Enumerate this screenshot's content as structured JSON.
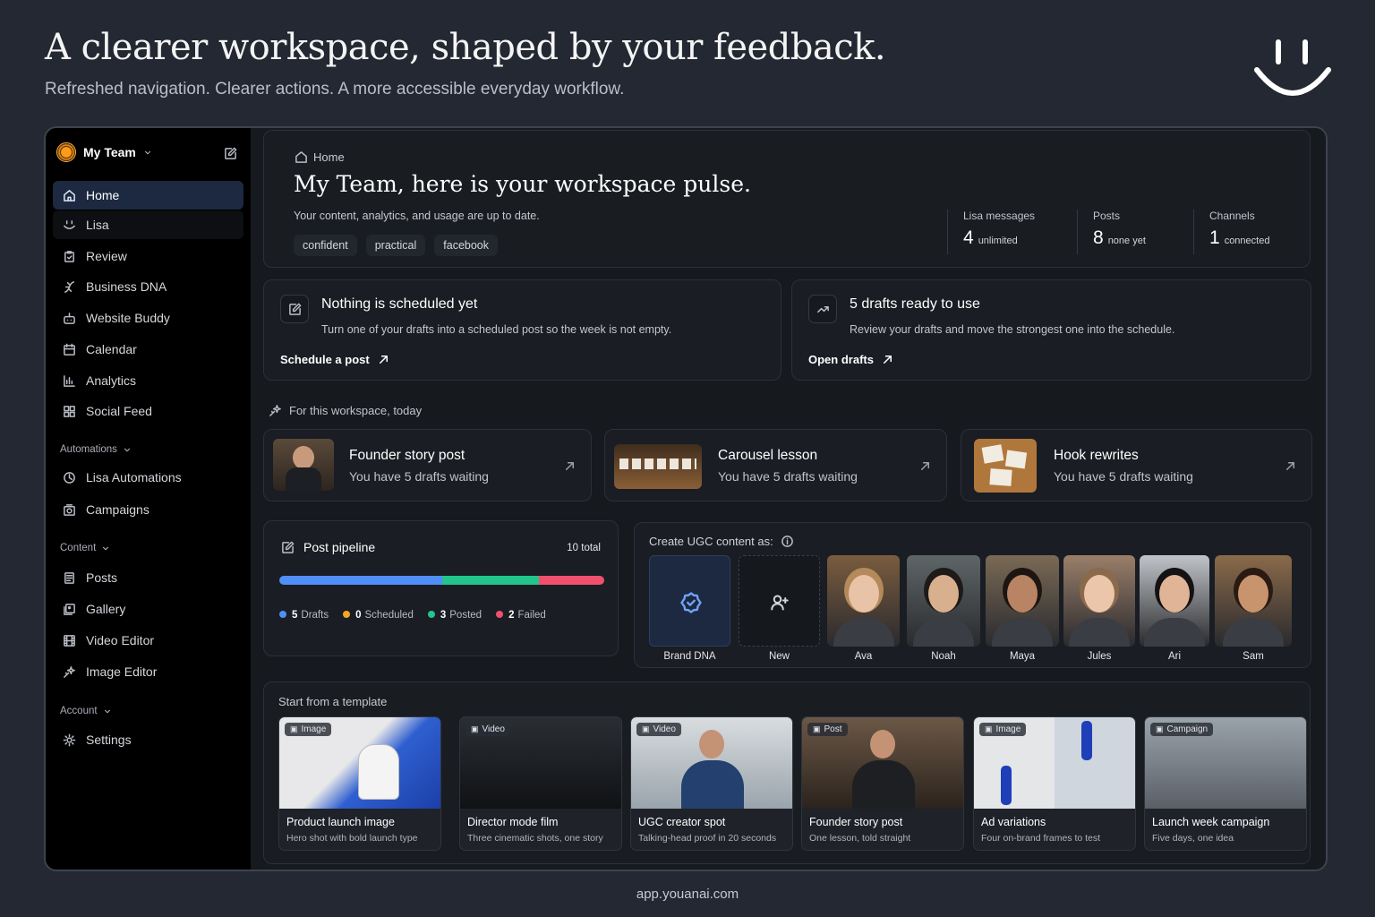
{
  "hero": {
    "title": "A clearer workspace, shaped by your feedback.",
    "subtitle": "Refreshed navigation. Clearer actions. A more accessible everyday workflow."
  },
  "footer": {
    "url": "app.youanai.com"
  },
  "sidebar": {
    "team_name": "My Team",
    "items": [
      {
        "label": "Home",
        "icon": "home-icon"
      },
      {
        "label": "Lisa",
        "icon": "smile-icon"
      },
      {
        "label": "Review",
        "icon": "clipboard-icon"
      },
      {
        "label": "Business DNA",
        "icon": "dna-icon"
      },
      {
        "label": "Website Buddy",
        "icon": "robot-icon"
      },
      {
        "label": "Calendar",
        "icon": "calendar-icon"
      },
      {
        "label": "Analytics",
        "icon": "bar-chart-icon"
      },
      {
        "label": "Social Feed",
        "icon": "grid-icon"
      }
    ],
    "automations": {
      "label": "Automations",
      "items": [
        {
          "label": "Lisa Automations",
          "icon": "clock-icon"
        },
        {
          "label": "Campaigns",
          "icon": "campaign-icon"
        }
      ]
    },
    "content": {
      "label": "Content",
      "items": [
        {
          "label": "Posts",
          "icon": "posts-icon"
        },
        {
          "label": "Gallery",
          "icon": "gallery-icon"
        },
        {
          "label": "Video Editor",
          "icon": "film-icon"
        },
        {
          "label": "Image Editor",
          "icon": "sparkle-icon"
        }
      ]
    },
    "account": {
      "label": "Account",
      "items": [
        {
          "label": "Settings",
          "icon": "gear-icon"
        }
      ]
    }
  },
  "pulse": {
    "breadcrumb": "Home",
    "title": "My Team, here is your workspace pulse.",
    "subtitle": "Your content, analytics, and usage are up to date.",
    "tags": [
      "confident",
      "practical",
      "facebook"
    ],
    "stats": [
      {
        "label": "Lisa messages",
        "value": "4",
        "unit": "unlimited"
      },
      {
        "label": "Posts",
        "value": "8",
        "unit": "none yet"
      },
      {
        "label": "Channels",
        "value": "1",
        "unit": "connected"
      }
    ]
  },
  "actions": [
    {
      "title": "Nothing is scheduled yet",
      "description": "Turn one of your drafts into a scheduled post so the week is not empty.",
      "link": "Schedule a post",
      "icon": "edit-icon"
    },
    {
      "title": "5 drafts ready to use",
      "description": "Review your drafts and move the strongest one into the schedule.",
      "link": "Open drafts",
      "icon": "trending-icon"
    }
  ],
  "suggestions": {
    "heading": "For this workspace, today",
    "items": [
      {
        "title": "Founder story post",
        "subtitle": "You have 5 drafts waiting"
      },
      {
        "title": "Carousel lesson",
        "subtitle": "You have 5 drafts waiting"
      },
      {
        "title": "Hook rewrites",
        "subtitle": "You have 5 drafts waiting"
      }
    ]
  },
  "pipeline": {
    "title": "Post pipeline",
    "total": "10 total",
    "segments": [
      {
        "label": "Drafts",
        "count": 5,
        "color": "#4f8ff7"
      },
      {
        "label": "Scheduled",
        "count": 0,
        "color": "#f5a623"
      },
      {
        "label": "Posted",
        "count": 3,
        "color": "#22c58b"
      },
      {
        "label": "Failed",
        "count": 2,
        "color": "#f0506e"
      }
    ]
  },
  "ugc": {
    "heading": "Create UGC content as:",
    "options": [
      {
        "label": "Brand DNA"
      },
      {
        "label": "New"
      },
      {
        "label": "Ava"
      },
      {
        "label": "Noah"
      },
      {
        "label": "Maya"
      },
      {
        "label": "Jules"
      },
      {
        "label": "Ari"
      },
      {
        "label": "Sam"
      }
    ]
  },
  "templates": {
    "heading": "Start from a template",
    "items": [
      {
        "badge": "Image",
        "title": "Product launch image",
        "subtitle": "Hero shot with bold launch type"
      },
      {
        "badge": "Video",
        "title": "Director mode film",
        "subtitle": "Three cinematic shots, one story"
      },
      {
        "badge": "Video",
        "title": "UGC creator spot",
        "subtitle": "Talking-head proof in 20 seconds"
      },
      {
        "badge": "Post",
        "title": "Founder story post",
        "subtitle": "One lesson, told straight"
      },
      {
        "badge": "Image",
        "title": "Ad variations",
        "subtitle": "Four on-brand frames to test"
      },
      {
        "badge": "Campaign",
        "title": "Launch week campaign",
        "subtitle": "Five days, one idea"
      }
    ]
  },
  "colors": {
    "accent": "#4f8ff7",
    "active_nav": "#1c2940",
    "background": "#232832"
  }
}
